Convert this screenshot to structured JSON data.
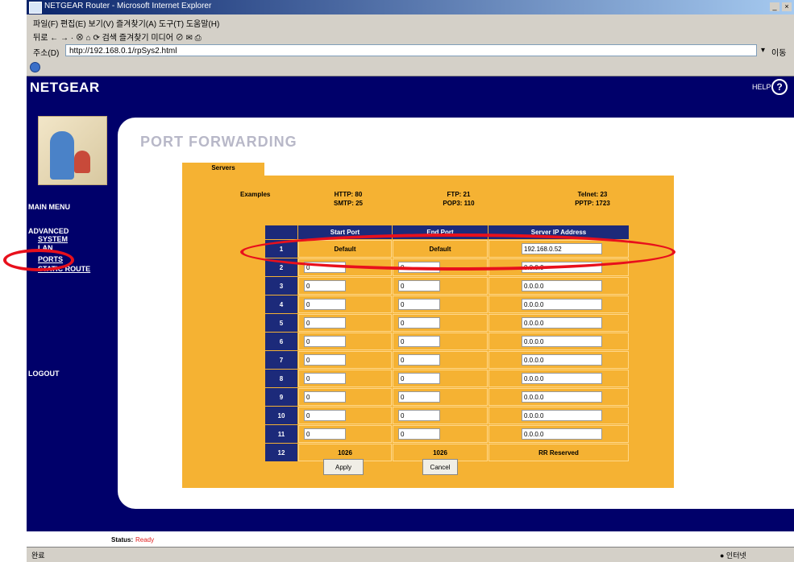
{
  "window": {
    "title": "NETGEAR Router - Microsoft Internet Explorer",
    "min_glyph": "_",
    "close_glyph": "×",
    "menu": "파일(F)  편집(E)  보기(V)  즐겨찾기(A)  도구(T)  도움말(H)",
    "toolbar": "뒤로 ← → ·  ⊗ ⌂ ⟳  검색  즐겨찾기  미디어  ⊘  ✉ ⎙",
    "address_label": "주소(D)",
    "address_url": "http://192.168.0.1/rpSys2.html",
    "go_arrow": "▾",
    "go_label": "이동"
  },
  "header": {
    "logo": "NETGEAR",
    "help_label": "HELP",
    "help_icon_glyph": "?"
  },
  "sidebar": {
    "main_menu": "MAIN MENU",
    "advanced": "ADVANCED",
    "system": "SYSTEM",
    "lan": "LAN",
    "ports": "PORTS",
    "static_route": "STATIC ROUTE",
    "logout": "LOGOUT"
  },
  "page": {
    "title": "PORT FORWARDING",
    "tab_label": "Servers",
    "examples_label": "Examples",
    "examples": [
      {
        "line1": "HTTP: 80",
        "line2": "SMTP: 25"
      },
      {
        "line1": "FTP: 21",
        "line2": "POP3: 110"
      },
      {
        "line1": "Telnet: 23",
        "line2": "PPTP: 1723"
      }
    ],
    "columns": [
      "",
      "Start Port",
      "End Port",
      "Server IP Address"
    ],
    "rows": [
      {
        "num": "1",
        "start": "Default",
        "end": "Default",
        "ip": "192.168.0.52"
      },
      {
        "num": "2",
        "start": "0",
        "end": "0",
        "ip": "0.0.0.0"
      },
      {
        "num": "3",
        "start": "0",
        "end": "0",
        "ip": "0.0.0.0"
      },
      {
        "num": "4",
        "start": "0",
        "end": "0",
        "ip": "0.0.0.0"
      },
      {
        "num": "5",
        "start": "0",
        "end": "0",
        "ip": "0.0.0.0"
      },
      {
        "num": "6",
        "start": "0",
        "end": "0",
        "ip": "0.0.0.0"
      },
      {
        "num": "7",
        "start": "0",
        "end": "0",
        "ip": "0.0.0.0"
      },
      {
        "num": "8",
        "start": "0",
        "end": "0",
        "ip": "0.0.0.0"
      },
      {
        "num": "9",
        "start": "0",
        "end": "0",
        "ip": "0.0.0.0"
      },
      {
        "num": "10",
        "start": "0",
        "end": "0",
        "ip": "0.0.0.0"
      },
      {
        "num": "11",
        "start": "0",
        "end": "0",
        "ip": "0.0.0.0"
      },
      {
        "num": "12",
        "start": "1026",
        "end": "1026",
        "ip": "RR Reserved"
      }
    ],
    "apply_label": "Apply",
    "cancel_label": "Cancel",
    "status_label": "Status:",
    "status_value": "Ready"
  },
  "ie_status": {
    "left": "완료",
    "right": "● 인터넷"
  },
  "colors": {
    "navy": "#00006a",
    "orange": "#f5b233",
    "table_header": "#1c2a7a",
    "annotation_red": "#e8101c"
  }
}
